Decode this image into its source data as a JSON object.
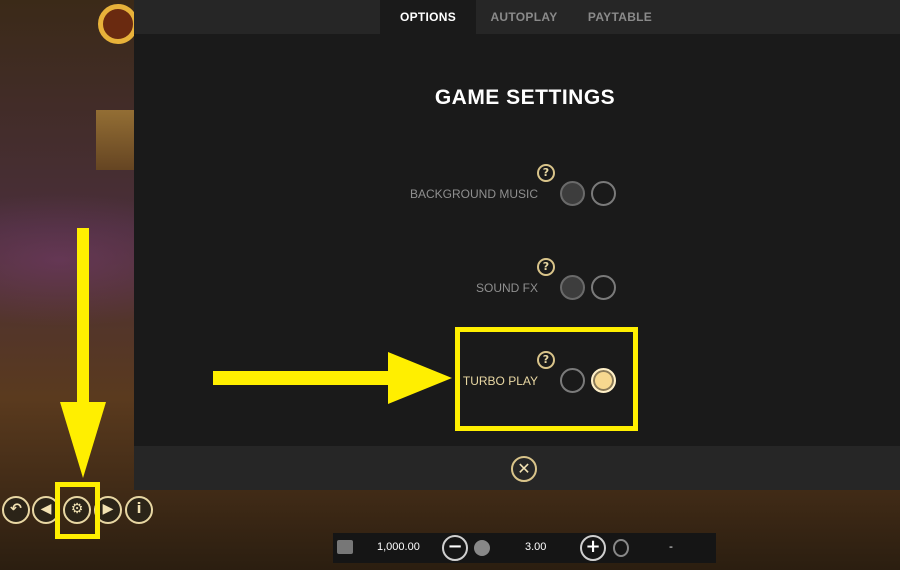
{
  "tabs": [
    {
      "label": "OPTIONS",
      "active": true
    },
    {
      "label": "AUTOPLAY",
      "active": false
    },
    {
      "label": "PAYTABLE",
      "active": false
    }
  ],
  "modal": {
    "title": "GAME SETTINGS",
    "help_glyph": "?",
    "close_glyph": "✕",
    "settings": [
      {
        "label": "BACKGROUND MUSIC",
        "state": "off"
      },
      {
        "label": "SOUND FX",
        "state": "off"
      },
      {
        "label": "TURBO PLAY",
        "state": "on"
      }
    ]
  },
  "controls": {
    "back_glyph": "↶",
    "prev_glyph": "◀",
    "settings_glyph": "⚙",
    "next_glyph": "▶",
    "info_glyph": "i"
  },
  "bet_bar": {
    "balance": "1,000.00",
    "bet": "3.00",
    "win": "-",
    "minus_glyph": "−",
    "plus_glyph": "+"
  },
  "colors": {
    "highlight": "#ffef00",
    "accent_gold": "#e8d7a3",
    "toggle_on": "#f7d88f",
    "panel_bg": "#1a1a1a"
  }
}
